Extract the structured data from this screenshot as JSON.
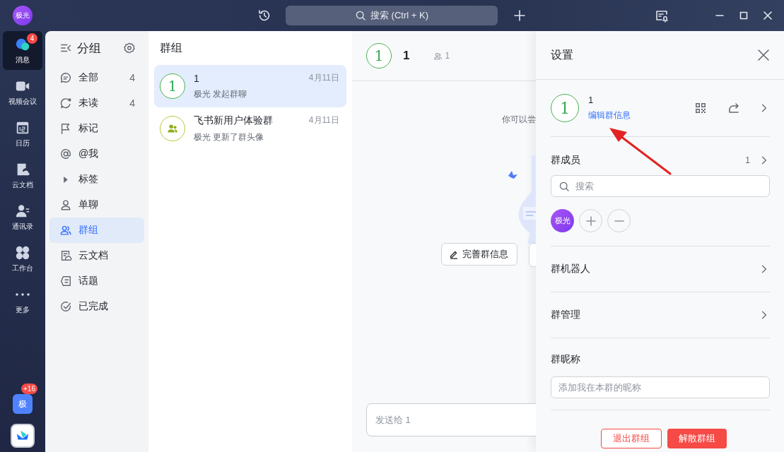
{
  "title_bar": {
    "avatar": "极光",
    "search": {
      "placeholder": "搜索 (Ctrl + K)"
    }
  },
  "rail": {
    "items": [
      {
        "label": "消息",
        "badge": "4",
        "selected": true
      },
      {
        "label": "视频会议",
        "selected": false
      },
      {
        "label": "日历",
        "selected": false
      },
      {
        "label": "云文档",
        "selected": false
      },
      {
        "label": "通讯录",
        "selected": false
      },
      {
        "label": "工作台",
        "selected": false
      },
      {
        "label": "更多",
        "selected": false
      }
    ],
    "tenant": {
      "label": "极",
      "badge": "+16"
    }
  },
  "groups_sidebar": {
    "title": "分组",
    "items": [
      {
        "label": "全部",
        "count": "4",
        "selected": false
      },
      {
        "label": "未读",
        "count": "4",
        "selected": false
      },
      {
        "label": "标记",
        "selected": false
      },
      {
        "label": "@我",
        "selected": false
      },
      {
        "label": "标签",
        "selected": false
      },
      {
        "label": "单聊",
        "selected": false
      },
      {
        "label": "群组",
        "selected": true
      },
      {
        "label": "云文档",
        "selected": false
      },
      {
        "label": "话题",
        "selected": false
      },
      {
        "label": "已完成",
        "selected": false
      }
    ]
  },
  "chat_list": {
    "title": "群组",
    "items": [
      {
        "name": "1",
        "avatar": "1",
        "kind": "number",
        "preview": "极光 发起群聊",
        "date": "4月11日",
        "selected": true
      },
      {
        "name": "飞书新用户体验群",
        "kind": "people",
        "preview": "极光 更新了群头像",
        "date": "4月11日",
        "selected": false
      }
    ]
  },
  "chat": {
    "avatar": "1",
    "title": "1",
    "member_count": "1",
    "hint": "你可以尝",
    "action": "完善群信息",
    "composer": {
      "placeholder": "发送给 1"
    }
  },
  "settings": {
    "title": "设置",
    "avatar": "1",
    "group_name": "1",
    "edit_link": "编辑群信息",
    "members": {
      "title": "群成员",
      "count": "1",
      "search_placeholder": "搜索",
      "avatars": [
        "极光"
      ]
    },
    "rows": [
      {
        "label": "群机器人"
      },
      {
        "label": "群管理"
      }
    ],
    "nickname": {
      "title": "群昵称",
      "placeholder": "添加我在本群的昵称"
    },
    "buttons": [
      {
        "label": "退出群组",
        "kind": "outline"
      },
      {
        "label": "解散群组",
        "kind": "danger"
      }
    ]
  }
}
